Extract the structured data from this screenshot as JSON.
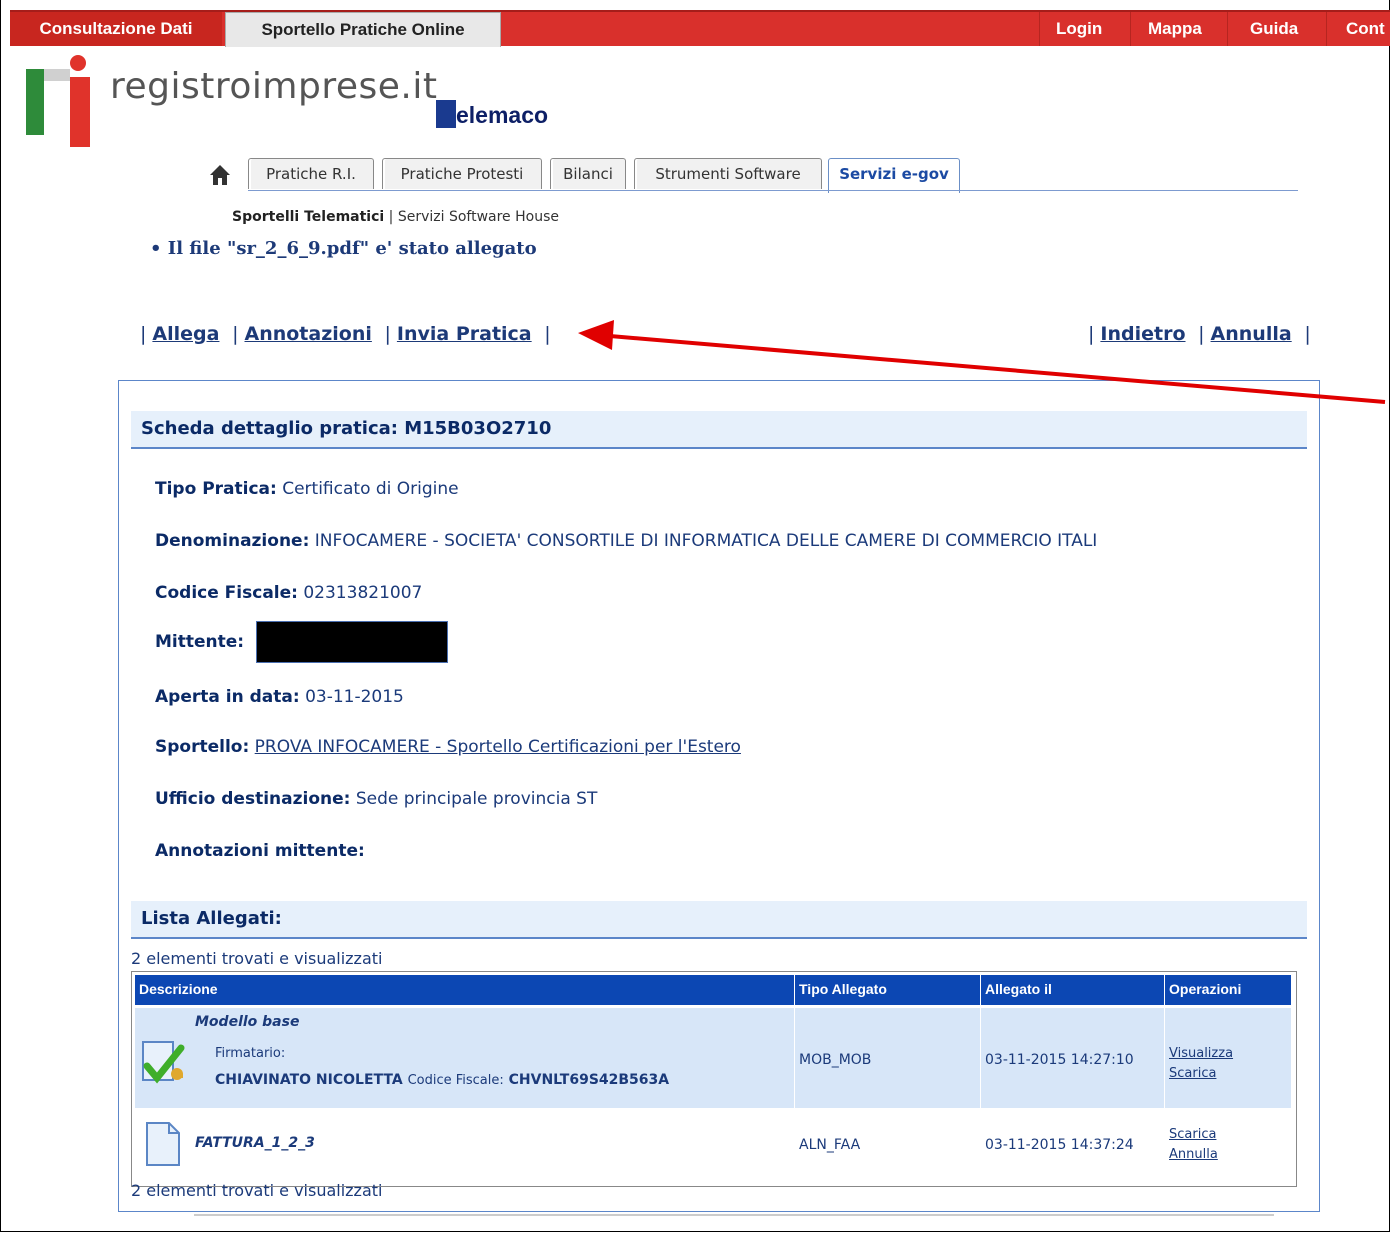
{
  "topbar": {
    "tab1": "Consultazione Dati",
    "tab2": "Sportello Pratiche Online",
    "login": "Login",
    "mappa": "Mappa",
    "guida": "Guida",
    "cont": "Cont"
  },
  "logo": {
    "text": "registroimprese.it",
    "telemaco": "elemaco"
  },
  "nav": {
    "tabs": [
      "Pratiche R.I.",
      "Pratiche Protesti",
      "Bilanci",
      "Strumenti Software",
      "Servizi e-gov"
    ],
    "active_index": 4,
    "sub_active": "Sportelli Telematici",
    "sub_sep": "|",
    "sub_other": "Servizi Software House"
  },
  "message": "• Il file \"sr_2_6_9.pdf\" e' stato allegato",
  "actions_left": [
    "Allega",
    "Annotazioni",
    "Invia Pratica"
  ],
  "actions_right": [
    "Indietro",
    "Annulla"
  ],
  "pipe": "|",
  "detail": {
    "title": "Scheda dettaglio pratica: M15B03O2710",
    "tipo_label": "Tipo Pratica:",
    "tipo_value": "Certificato di Origine",
    "denom_label": "Denominazione:",
    "denom_value": "INFOCAMERE - SOCIETA' CONSORTILE DI INFORMATICA DELLE CAMERE DI COMMERCIO ITALI",
    "cf_label": "Codice Fiscale:",
    "cf_value": "02313821007",
    "mittente_label": "Mittente:",
    "aperta_label": "Aperta in data:",
    "aperta_value": "03-11-2015",
    "sportello_label": "Sportello:",
    "sportello_value": "PROVA INFOCAMERE - Sportello Certificazioni per l'Estero",
    "ufficio_label": "Ufficio destinazione:",
    "ufficio_value": "Sede principale provincia ST",
    "annot_label": "Annotazioni mittente:"
  },
  "allegati": {
    "title": "Lista Allegati:",
    "found": "2 elementi trovati e visualizzati",
    "headers": [
      "Descrizione",
      "Tipo Allegato",
      "Allegato il",
      "Operazioni"
    ],
    "rows": [
      {
        "name": "Modello base",
        "firmatario_label": "Firmatario:",
        "firmatario_name": "CHIAVINATO NICOLETTA",
        "cf_label": "Codice Fiscale:",
        "cf_value": "CHVNLT69S42B563A",
        "tipo": "MOB_MOB",
        "data": "03-11-2015 14:27:10",
        "ops": [
          "Visualizza",
          "Scarica"
        ]
      },
      {
        "name": "FATTURA_1_2_3",
        "tipo": "ALN_FAA",
        "data": "03-11-2015 14:37:24",
        "ops": [
          "Scarica",
          "Annulla"
        ]
      }
    ]
  },
  "colors": {
    "topbar_red": "#d9302c",
    "header_blue": "#0c47b3",
    "panel_light": "#e6f0fb",
    "arrow_red": "#e00000"
  }
}
